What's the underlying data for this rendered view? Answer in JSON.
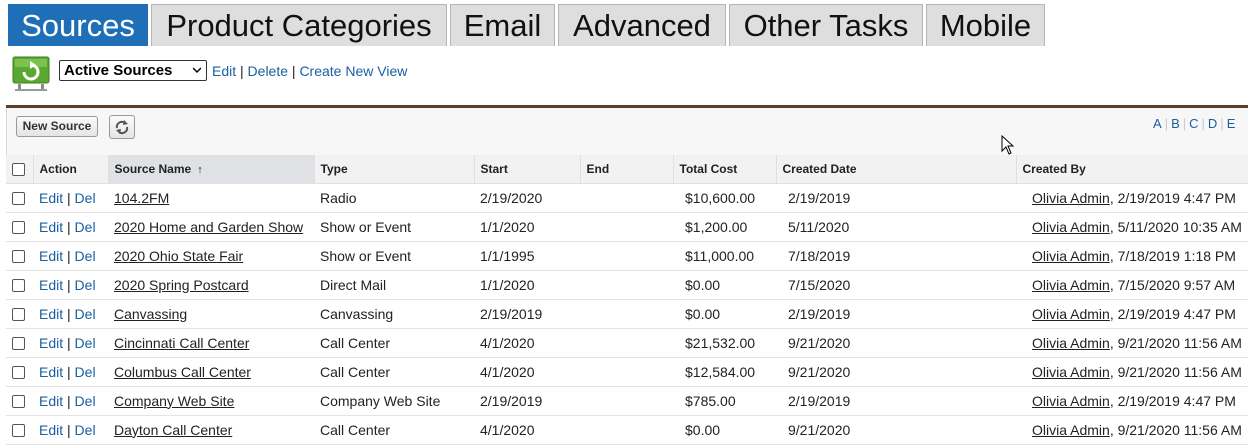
{
  "tabs": [
    {
      "label": "Sources",
      "active": true
    },
    {
      "label": "Product Categories",
      "active": false
    },
    {
      "label": "Email",
      "active": false
    },
    {
      "label": "Advanced",
      "active": false
    },
    {
      "label": "Other Tasks",
      "active": false
    },
    {
      "label": "Mobile",
      "active": false
    }
  ],
  "view": {
    "selected": "Active Sources",
    "edit": "Edit",
    "delete": "Delete",
    "create": "Create New View",
    "sep": "|"
  },
  "toolbar": {
    "new_source": "New Source"
  },
  "alpha": [
    "A",
    "B",
    "C",
    "D",
    "E"
  ],
  "columns": {
    "action": "Action",
    "source_name": "Source Name",
    "type": "Type",
    "start": "Start",
    "end": "End",
    "total_cost": "Total Cost",
    "created_date": "Created Date",
    "created_by": "Created By"
  },
  "row_actions": {
    "edit": "Edit",
    "del": "Del",
    "sep": "|"
  },
  "rows": [
    {
      "name": "104.2FM",
      "type": "Radio",
      "start": "2/19/2020",
      "end": "",
      "cost": "$10,600.00",
      "created": "2/19/2019",
      "by": "Olivia Admin",
      "by_when": ", 2/19/2019 4:47 PM"
    },
    {
      "name": "2020 Home and Garden Show",
      "type": "Show or Event",
      "start": "1/1/2020",
      "end": "",
      "cost": "$1,200.00",
      "created": "5/11/2020",
      "by": "Olivia Admin",
      "by_when": ", 5/11/2020 10:35 AM"
    },
    {
      "name": "2020 Ohio State Fair",
      "type": "Show or Event",
      "start": "1/1/1995",
      "end": "",
      "cost": "$11,000.00",
      "created": "7/18/2019",
      "by": "Olivia Admin",
      "by_when": ", 7/18/2019 1:18 PM"
    },
    {
      "name": "2020 Spring Postcard",
      "type": "Direct Mail",
      "start": "1/1/2020",
      "end": "",
      "cost": "$0.00",
      "created": "7/15/2020",
      "by": "Olivia Admin",
      "by_when": ", 7/15/2020 9:57 AM"
    },
    {
      "name": "Canvassing",
      "type": "Canvassing",
      "start": "2/19/2019",
      "end": "",
      "cost": "$0.00",
      "created": "2/19/2019",
      "by": "Olivia Admin",
      "by_when": ", 2/19/2019 4:47 PM"
    },
    {
      "name": "Cincinnati Call Center",
      "type": "Call Center",
      "start": "4/1/2020",
      "end": "",
      "cost": "$21,532.00",
      "created": "9/21/2020",
      "by": "Olivia Admin",
      "by_when": ", 9/21/2020 11:56 AM"
    },
    {
      "name": "Columbus Call Center",
      "type": "Call Center",
      "start": "4/1/2020",
      "end": "",
      "cost": "$12,584.00",
      "created": "9/21/2020",
      "by": "Olivia Admin",
      "by_when": ", 9/21/2020 11:56 AM"
    },
    {
      "name": "Company Web Site",
      "type": "Company Web Site",
      "start": "2/19/2019",
      "end": "",
      "cost": "$785.00",
      "created": "2/19/2019",
      "by": "Olivia Admin",
      "by_when": ", 2/19/2019 4:47 PM"
    },
    {
      "name": "Dayton Call Center",
      "type": "Call Center",
      "start": "4/1/2020",
      "end": "",
      "cost": "$0.00",
      "created": "9/21/2020",
      "by": "Olivia Admin",
      "by_when": ", 9/21/2020 11:56 AM"
    }
  ],
  "icons": {
    "view_icon": "refresh-view-icon",
    "select_arrow": "chevron-down-icon",
    "refresh": "refresh-icon",
    "sort": "sort-ascending-icon",
    "cursor": "mouse-pointer-icon"
  },
  "colors": {
    "active_tab": "#1f6fb8",
    "link": "#1a5fa3",
    "rule": "#5a3f2a"
  }
}
